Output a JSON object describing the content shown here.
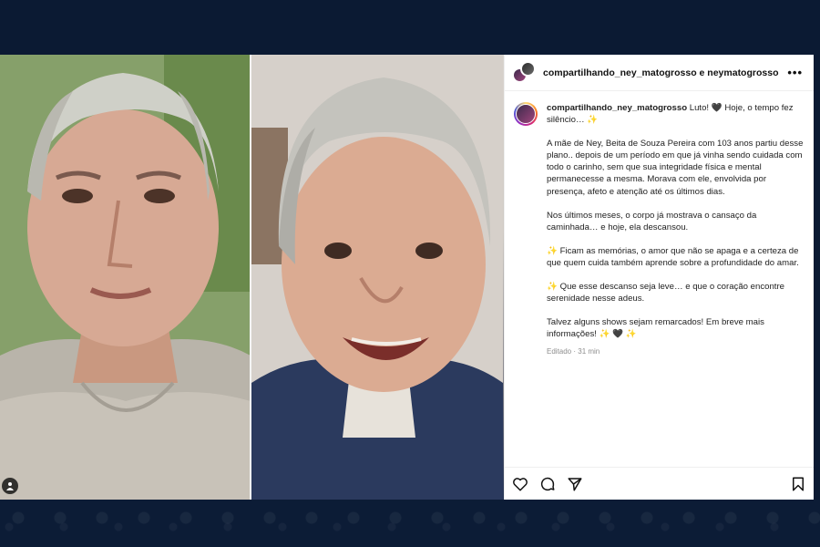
{
  "header": {
    "title": "compartilhando_ney_matogrosso e neymatogrosso",
    "more": "•••"
  },
  "caption": {
    "username": "compartilhando_ney_matogrosso",
    "line1": "Luto! 🖤 Hoje, o tempo fez silêncio… ✨",
    "para1": "A mãe de Ney, Beita de Souza Pereira com 103 anos partiu desse plano.. depois de um período em que já vinha sendo cuidada com todo o carinho, sem que sua integridade física e mental permanecesse a mesma. Morava com ele, envolvida por presença, afeto e atenção até os últimos dias.",
    "para2": "Nos últimos meses, o corpo já mostrava o cansaço da caminhada… e hoje, ela descansou.",
    "para3": "✨ Ficam as memórias, o amor que não se apaga e a certeza de que quem cuida também aprende sobre a profundidade do amar.",
    "para4": "✨ Que esse descanso seja leve… e que o coração encontre serenidade nesse adeus.",
    "para5": "Talvez alguns shows sejam remarcados! Em breve mais informações! ✨ 🖤 ✨",
    "edited": "Editado · 31 min"
  },
  "icons": {
    "tag": "person-tag-icon",
    "like": "heart-icon",
    "comment": "comment-icon",
    "share": "send-icon",
    "save": "bookmark-icon"
  },
  "colors": {
    "page_background": "#0b1a33",
    "card_background": "#ffffff",
    "text": "#222222",
    "muted": "#8e8e8e"
  }
}
